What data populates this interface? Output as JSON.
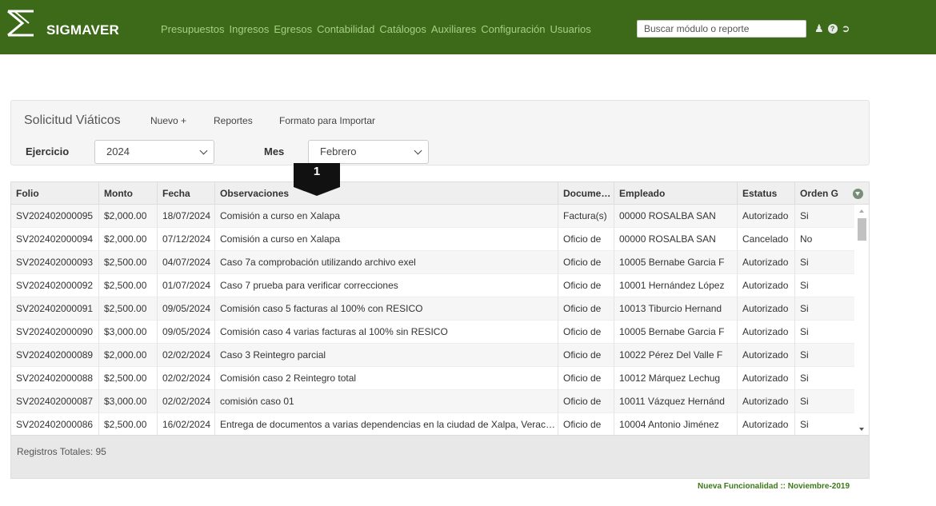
{
  "app": {
    "name": "SIGMAVER",
    "nav": [
      "Presupuestos",
      "Ingresos",
      "Egresos",
      "Contabilidad",
      "Catálogos",
      "Auxiliares",
      "Configuración",
      "Usuarios"
    ],
    "search_placeholder": "Buscar módulo o reporte",
    "icons": [
      "user-icon",
      "help-icon",
      "logout-icon"
    ]
  },
  "panel": {
    "title": "Solicitud Viáticos",
    "links": [
      "Nuevo +",
      "Reportes",
      "Formato para Importar"
    ],
    "ejercicio_label": "Ejercicio",
    "ejercicio_value": "2024",
    "mes_label": "Mes",
    "mes_value": "Febrero"
  },
  "marker": "1",
  "grid": {
    "columns": [
      "Folio",
      "Monto",
      "Fecha",
      "Observaciones",
      "Documentos",
      "Empleado",
      "Estatus",
      "Orden G"
    ],
    "rows": [
      [
        "SV202402000095",
        "$2,000.00",
        "18/07/2024",
        "Comisión a curso en Xalapa",
        "Factura(s)",
        "00000 ROSALBA SAN",
        "Autorizado",
        "Si"
      ],
      [
        "SV202402000094",
        "$2,000.00",
        "07/12/2024",
        "Comisión a curso en Xalapa",
        "Oficio de",
        "00000 ROSALBA SAN",
        "Cancelado",
        "No"
      ],
      [
        "SV202402000093",
        "$2,500.00",
        "04/07/2024",
        "Caso 7a comprobación utilizando archivo exel",
        "Oficio de",
        "10005 Bernabe Garcia F",
        "Autorizado",
        "Si"
      ],
      [
        "SV202402000092",
        "$2,500.00",
        "01/07/2024",
        "Caso 7 prueba para verificar correcciones",
        "Oficio de",
        "10001 Hernández López",
        "Autorizado",
        "Si"
      ],
      [
        "SV202402000091",
        "$2,500.00",
        "09/05/2024",
        "Comisión caso 5 facturas al 100% con RESICO",
        "Oficio de",
        "10013 Tiburcio Hernand",
        "Autorizado",
        "Si"
      ],
      [
        "SV202402000090",
        "$3,000.00",
        "09/05/2024",
        "Comisión caso 4 varias facturas al 100% sin RESICO",
        "Oficio de",
        "10005 Bernabe Garcia F",
        "Autorizado",
        "Si"
      ],
      [
        "SV202402000089",
        "$2,000.00",
        "02/02/2024",
        "Caso 3 Reintegro parcial",
        "Oficio de",
        "10022 Pérez Del Valle F",
        "Autorizado",
        "Si"
      ],
      [
        "SV202402000088",
        "$2,500.00",
        "02/02/2024",
        "Comisión caso 2 Reintegro total",
        "Oficio de",
        "10012 Márquez Lechug",
        "Autorizado",
        "Si"
      ],
      [
        "SV202402000087",
        "$3,000.00",
        "02/02/2024",
        "comisión caso 01",
        "Oficio de",
        "10011 Vázquez Hernánd",
        "Autorizado",
        "Si"
      ],
      [
        "SV202402000086",
        "$2,500.00",
        "16/02/2024",
        "Entrega de documentos a varias dependencias en la ciudad de Xalpa, Veracruz",
        "Oficio de",
        "10004 Antonio Jiménez",
        "Autorizado",
        "Si"
      ]
    ],
    "total_label": "Registros Totales: 95"
  },
  "footer_note": "Nueva Funcionalidad :: Noviembre-2019"
}
